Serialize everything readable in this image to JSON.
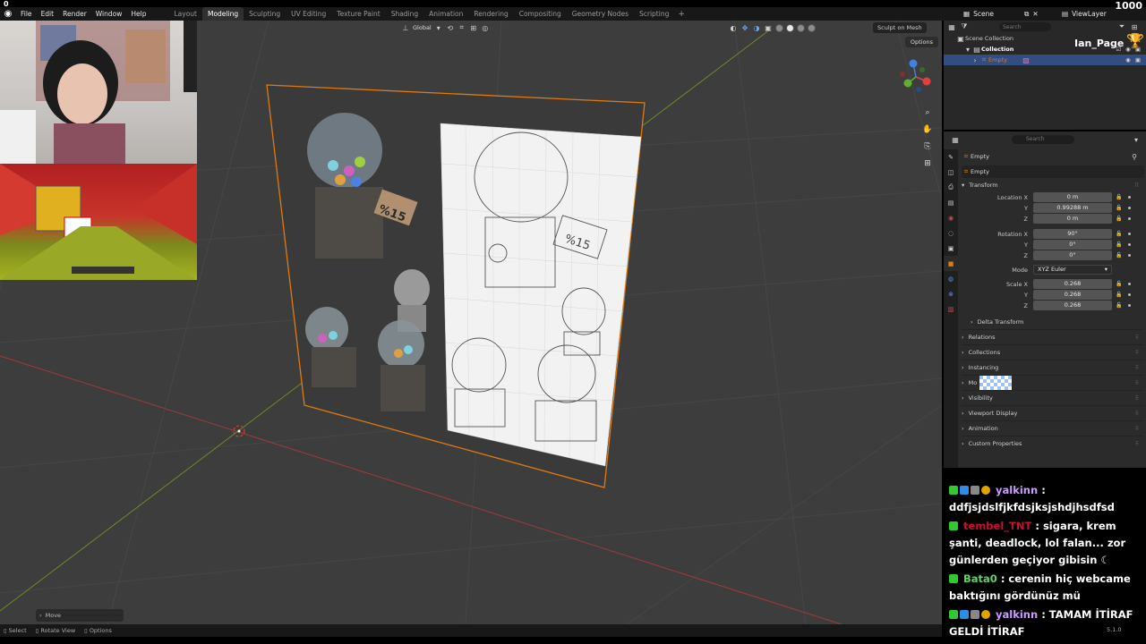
{
  "overlay": {
    "counter": "1000",
    "counter_top": "0",
    "streamer_name": "Ian_Page"
  },
  "menu": {
    "items": [
      "File",
      "Edit",
      "Render",
      "Window",
      "Help"
    ],
    "workspaces": [
      "Layout",
      "Modeling",
      "Sculpting",
      "UV Editing",
      "Texture Paint",
      "Shading",
      "Animation",
      "Rendering",
      "Compositing",
      "Geometry Nodes",
      "Scripting"
    ],
    "active_workspace": "Modeling",
    "scene": "Scene",
    "view_layer": "ViewLayer"
  },
  "viewport": {
    "orientation": "Global",
    "sculpt_on_mesh": "Sculpt on Mesh",
    "options": "Options",
    "move_panel": "Move",
    "reference_labels": [
      "%15",
      "%15",
      "%15"
    ]
  },
  "statusbar": {
    "select": "Select",
    "rotate": "Rotate View",
    "options": "Options",
    "version": "5.1.0"
  },
  "outliner": {
    "search_placeholder": "Search",
    "scene_collection": "Scene Collection",
    "collection": "Collection",
    "object": "Empty"
  },
  "properties": {
    "search_placeholder": "Search",
    "object_name": "Empty",
    "data_name": "Empty",
    "transform_title": "Transform",
    "location": {
      "label_x": "Location X",
      "x": "0 m",
      "y": "0.99288 m",
      "z": "0 m"
    },
    "rotation": {
      "label_x": "Rotation X",
      "x": "90°",
      "y": "0°",
      "z": "0°"
    },
    "mode_label": "Mode",
    "mode": "XYZ Euler",
    "scale": {
      "label_x": "Scale X",
      "x": "0.268",
      "y": "0.268",
      "z": "0.268"
    },
    "axis_y": "Y",
    "axis_z": "Z",
    "delta": "Delta Transform",
    "panels": [
      "Relations",
      "Collections",
      "Instancing",
      "Mo",
      "Visibility",
      "Viewport Display",
      "Animation",
      "Custom Properties"
    ]
  },
  "chat": [
    {
      "user": "yalkinn",
      "color": "purple",
      "text": "ddfjsjdslfjkfdsjksjshdjhsdfsd"
    },
    {
      "user": "tembel_TNT",
      "color": "red",
      "text": "sigara, krem şanti, deadlock, lol falan... zor günlerden geçiyor gibisin"
    },
    {
      "user": "Bata0",
      "color": "green",
      "text": "cerenin hiç webcame baktığını gördünüz mü"
    },
    {
      "user": "yalkinn",
      "color": "purple",
      "text": "TAMAM İTİRAF GELDİ İTİRAF"
    }
  ],
  "colors": {
    "selection": "#334d80",
    "accent_orange": "#e07a10",
    "viewport_bg": "#3d3d3d"
  }
}
